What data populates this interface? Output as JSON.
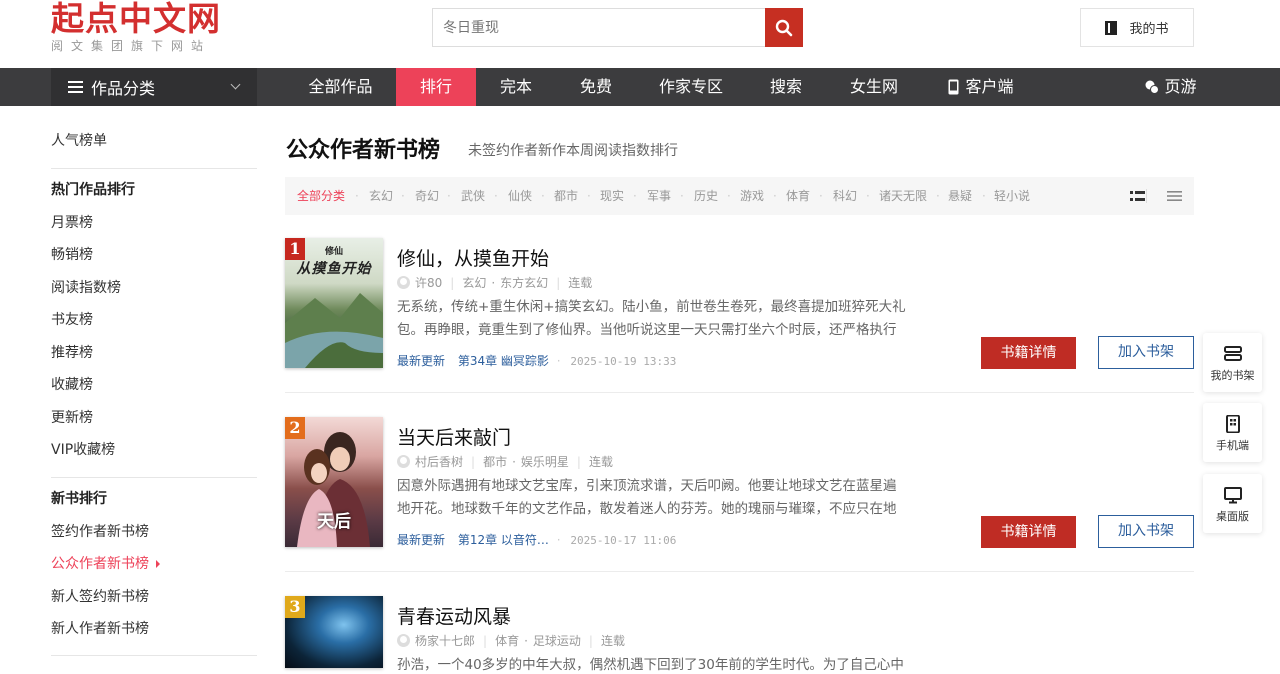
{
  "logo": {
    "main": "起点中文网",
    "sub": "阅文集团旗下网站"
  },
  "search": {
    "placeholder": "冬日重现"
  },
  "header": {
    "mybook": "我的书"
  },
  "nav": {
    "category": "作品分类",
    "items": [
      "全部作品",
      "排行",
      "完本",
      "免费",
      "作家专区",
      "搜索",
      "女生网",
      "客户端",
      "页游"
    ],
    "active_index": 1
  },
  "sidebar": {
    "popular": "人气榜单",
    "hot_heading": "热门作品排行",
    "hot_items": [
      "月票榜",
      "畅销榜",
      "阅读指数榜",
      "书友榜",
      "推荐榜",
      "收藏榜",
      "更新榜",
      "VIP收藏榜"
    ],
    "new_heading": "新书排行",
    "new_items": [
      "签约作者新书榜",
      "公众作者新书榜",
      "新人签约新书榜",
      "新人作者新书榜"
    ],
    "active_item": "公众作者新书榜"
  },
  "page": {
    "title": "公众作者新书榜",
    "subtitle": "未签约作者新作本周阅读指数排行"
  },
  "filter": {
    "items": [
      "全部分类",
      "玄幻",
      "奇幻",
      "武侠",
      "仙侠",
      "都市",
      "现实",
      "军事",
      "历史",
      "游戏",
      "体育",
      "科幻",
      "诸天无限",
      "悬疑",
      "轻小说"
    ],
    "active_index": 0
  },
  "books": [
    {
      "rank": "1",
      "title": "修仙，从摸鱼开始",
      "author": "许80",
      "genre": "玄幻",
      "subgenre": "东方玄幻",
      "status": "连载",
      "desc": "无系统，传统+重生休闲+搞笑玄幻。陆小鱼，前世卷生卷死，最终喜提加班猝死大礼包。再睁眼，竟重生到了修仙界。当他听说这里一天只需打坐六个时辰，还严格执行",
      "update_label": "最新更新",
      "chapter": "第34章 幽冥踪影",
      "time": "2025-10-19 13:33",
      "cover_title": "修仙\n从摸鱼开始",
      "rank_color": "#c6281f"
    },
    {
      "rank": "2",
      "title": "当天后来敲门",
      "author": "村后香树",
      "genre": "都市",
      "subgenre": "娱乐明星",
      "status": "连载",
      "desc": "因意外际遇拥有地球文艺宝库，引来顶流求谱，天后叩阙。他要让地球文艺在蓝星遍地开花。地球数千年的文艺作品，散发着迷人的芬芳。她的瑰丽与璀璨，不应只在地",
      "update_label": "最新更新",
      "chapter": "第12章 以音符…",
      "time": "2025-10-17 11:06",
      "cover_title": "天后",
      "rank_color": "#e36d1c"
    },
    {
      "rank": "3",
      "title": "青春运动风暴",
      "author": "杨家十七郎",
      "genre": "体育",
      "subgenre": "足球运动",
      "status": "连载",
      "desc": "孙浩，一个40多岁的中年大叔，偶然机遇下回到了30年前的学生时代。为了自己心中",
      "update_label": "最新更新",
      "chapter": "",
      "time": "",
      "cover_title": "",
      "rank_color": "#e0a91b"
    }
  ],
  "buttons": {
    "detail": "书籍详情",
    "shelf": "加入书架"
  },
  "float": {
    "shelf": "我的书架",
    "mobile": "手机端",
    "desktop": "桌面版"
  }
}
